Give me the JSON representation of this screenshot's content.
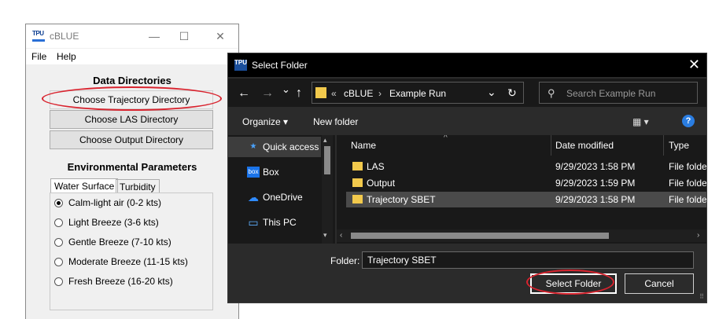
{
  "cblue": {
    "title": "cBLUE",
    "icon_text": "TPU",
    "menu": [
      "File",
      "Help"
    ],
    "window_controls": {
      "minimize": "—",
      "maximize": "☐",
      "close": "✕"
    },
    "data_dir_title": "Data Directories",
    "buttons": [
      "Choose Trajectory Directory",
      "Choose LAS Directory",
      "Choose Output Directory"
    ],
    "env_title": "Environmental Parameters",
    "tabs": [
      "Water Surface",
      "Turbidity"
    ],
    "active_tab": "Water Surface",
    "radio_options": [
      "Calm-light air (0-2 kts)",
      "Light Breeze (3-6 kts)",
      "Gentle Breeze (7-10 kts)",
      "Moderate Breeze (11-15 kts)",
      "Fresh Breeze (16-20 kts)"
    ],
    "selected_radio": "Calm-light air (0-2 kts)"
  },
  "dialog": {
    "title": "Select Folder",
    "icon_text": "TPU",
    "close": "✕",
    "nav": {
      "back": "←",
      "forward": "→",
      "recent": "⌄",
      "up": "↑"
    },
    "address": {
      "prefix": "«",
      "parts": [
        "cBLUE",
        "Example Run"
      ],
      "separator": "›"
    },
    "dropdown": "⌄",
    "refresh": "↻",
    "search_icon": "⚲",
    "search_placeholder": "Search Example Run",
    "toolbar": {
      "organize": "Organize ▾",
      "new_folder": "New folder",
      "view": "▦ ▾",
      "help": "?"
    },
    "nav_pane": [
      {
        "icon": "★",
        "label": "Quick access",
        "selected": true
      },
      {
        "icon": "box",
        "label": "Box",
        "selected": false
      },
      {
        "icon": "☁",
        "label": "OneDrive",
        "selected": false
      },
      {
        "icon": "▭",
        "label": "This PC",
        "selected": false
      }
    ],
    "columns": [
      "Name",
      "Date modified",
      "Type"
    ],
    "sort_indicator": "^",
    "files": [
      {
        "name": "LAS",
        "date": "9/29/2023 1:58 PM",
        "type": "File folde"
      },
      {
        "name": "Output",
        "date": "9/29/2023 1:59 PM",
        "type": "File folde"
      },
      {
        "name": "Trajectory SBET",
        "date": "9/29/2023 1:58 PM",
        "type": "File folde"
      }
    ],
    "selected_file": "Trajectory SBET",
    "folder_label": "Folder:",
    "folder_value": "Trajectory SBET",
    "select_button": "Select Folder",
    "cancel_button": "Cancel"
  },
  "annotations": {
    "color": "#d9232e"
  }
}
